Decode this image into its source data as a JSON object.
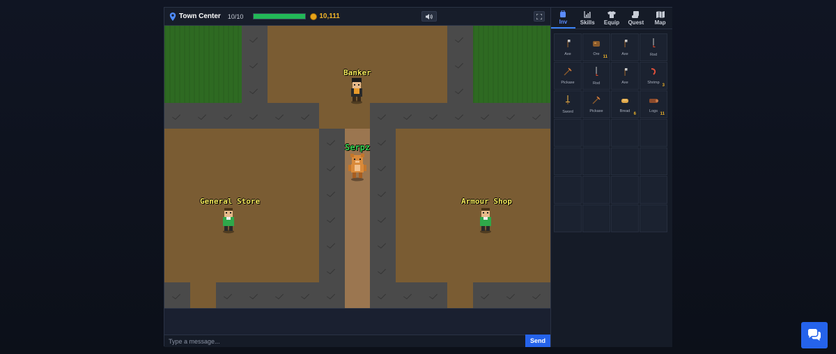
{
  "topbar": {
    "location": "Town Center",
    "hp_text": "10/10",
    "hp_fraction": 1.0,
    "coins": "10,111"
  },
  "map": {
    "npcs": [
      {
        "label": "Banker"
      },
      {
        "label": "General Store"
      },
      {
        "label": "Armour Shop"
      }
    ],
    "player": {
      "label": "Serpz"
    }
  },
  "chat": {
    "placeholder": "Type a message...",
    "send_label": "Send"
  },
  "side": {
    "tabs": [
      {
        "label": "Inv",
        "icon": "backpack-icon",
        "active": true
      },
      {
        "label": "Skills",
        "icon": "chart-icon",
        "active": false
      },
      {
        "label": "Equip",
        "icon": "shirt-icon",
        "active": false
      },
      {
        "label": "Quest",
        "icon": "scroll-icon",
        "active": false
      },
      {
        "label": "Map",
        "icon": "map-icon",
        "active": false
      }
    ],
    "inventory": [
      {
        "name": "Axe",
        "qty": "",
        "icon": "axe-icon"
      },
      {
        "name": "Ore",
        "qty": "11",
        "icon": "ore-icon"
      },
      {
        "name": "Axe",
        "qty": "",
        "icon": "axe-icon"
      },
      {
        "name": "Rod",
        "qty": "",
        "icon": "rod-icon"
      },
      {
        "name": "Pickaxe",
        "qty": "",
        "icon": "pickaxe-icon"
      },
      {
        "name": "Rod",
        "qty": "",
        "icon": "rod-icon"
      },
      {
        "name": "Axe",
        "qty": "",
        "icon": "axe-icon"
      },
      {
        "name": "Shrimp",
        "qty": "3",
        "icon": "shrimp-icon"
      },
      {
        "name": "Sword",
        "qty": "",
        "icon": "sword-icon"
      },
      {
        "name": "Pickaxe",
        "qty": "",
        "icon": "pickaxe-icon"
      },
      {
        "name": "Bread",
        "qty": "6",
        "icon": "bread-icon"
      },
      {
        "name": "Logs",
        "qty": "11",
        "icon": "logs-icon"
      }
    ],
    "empty_slots": 16
  },
  "colors": {
    "accent": "#2563eb",
    "hp": "#22b857",
    "gold": "#f0b429",
    "npc_label": "#f4e85a",
    "player_label": "#39d353"
  }
}
